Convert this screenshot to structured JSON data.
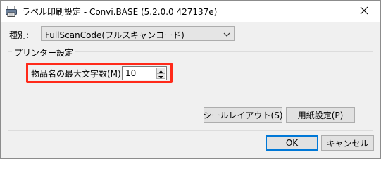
{
  "window": {
    "title": "ラベル印刷設定 - Convi.BASE (5.2.0.0 427137e)",
    "app_icon": "printer-icon",
    "close_icon": "close-icon"
  },
  "type": {
    "label": "種別:",
    "selected": "FullScanCode(フルスキャンコード)",
    "chevron_icon": "chevron-down-icon"
  },
  "printer_group": {
    "legend": "プリンター設定",
    "max_chars_label": "物品名の最大文字数(M):",
    "max_chars_value": "10",
    "highlight_color": "#ff2a1a"
  },
  "buttons": {
    "seal_layout": "シールレイアウト(S)",
    "paper_settings": "用紙設定(P)",
    "ok": "OK",
    "cancel": "キャンセル"
  },
  "colors": {
    "dialog_bg": "#f0f0f0",
    "accent": "#0078d7"
  }
}
